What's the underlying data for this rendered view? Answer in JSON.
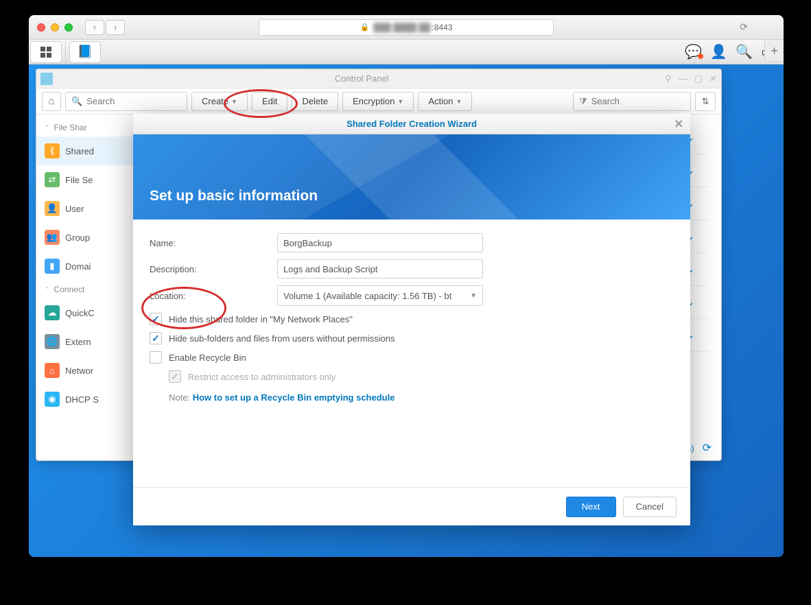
{
  "browser": {
    "url_port": ":8443"
  },
  "controlPanel": {
    "title": "Control Panel",
    "searchPlaceholder": "Search",
    "filterPlaceholder": "Search",
    "toolbar": {
      "create": "Create",
      "edit": "Edit",
      "delete": "Delete",
      "encryption": "Encryption",
      "action": "Action"
    },
    "itemsLabel": "em(s)"
  },
  "sidebar": {
    "section1": "File Shar",
    "section2": "Connect",
    "items": {
      "shared": "Shared",
      "fileservices": "File Se",
      "user": "User",
      "group": "Group",
      "domain": "Domai",
      "quickconnect": "QuickC",
      "external": "Extern",
      "network": "Networ",
      "dhcp": "DHCP S"
    }
  },
  "wizard": {
    "title": "Shared Folder Creation Wizard",
    "heading": "Set up basic information",
    "labels": {
      "name": "Name:",
      "description": "Description:",
      "location": "Location:"
    },
    "values": {
      "name": "BorgBackup",
      "description": "Logs and Backup Script",
      "location": "Volume 1 (Available capacity: 1.56 TB) - bt"
    },
    "checkboxes": {
      "hideNetwork": "Hide this shared folder in \"My Network Places\"",
      "hideSubfolders": "Hide sub-folders and files from users without permissions",
      "recycleBin": "Enable Recycle Bin",
      "restrictAdmin": "Restrict access to administrators only"
    },
    "noteLabel": "Note:",
    "noteLink": "How to set up a Recycle Bin emptying schedule",
    "buttons": {
      "next": "Next",
      "cancel": "Cancel"
    }
  }
}
